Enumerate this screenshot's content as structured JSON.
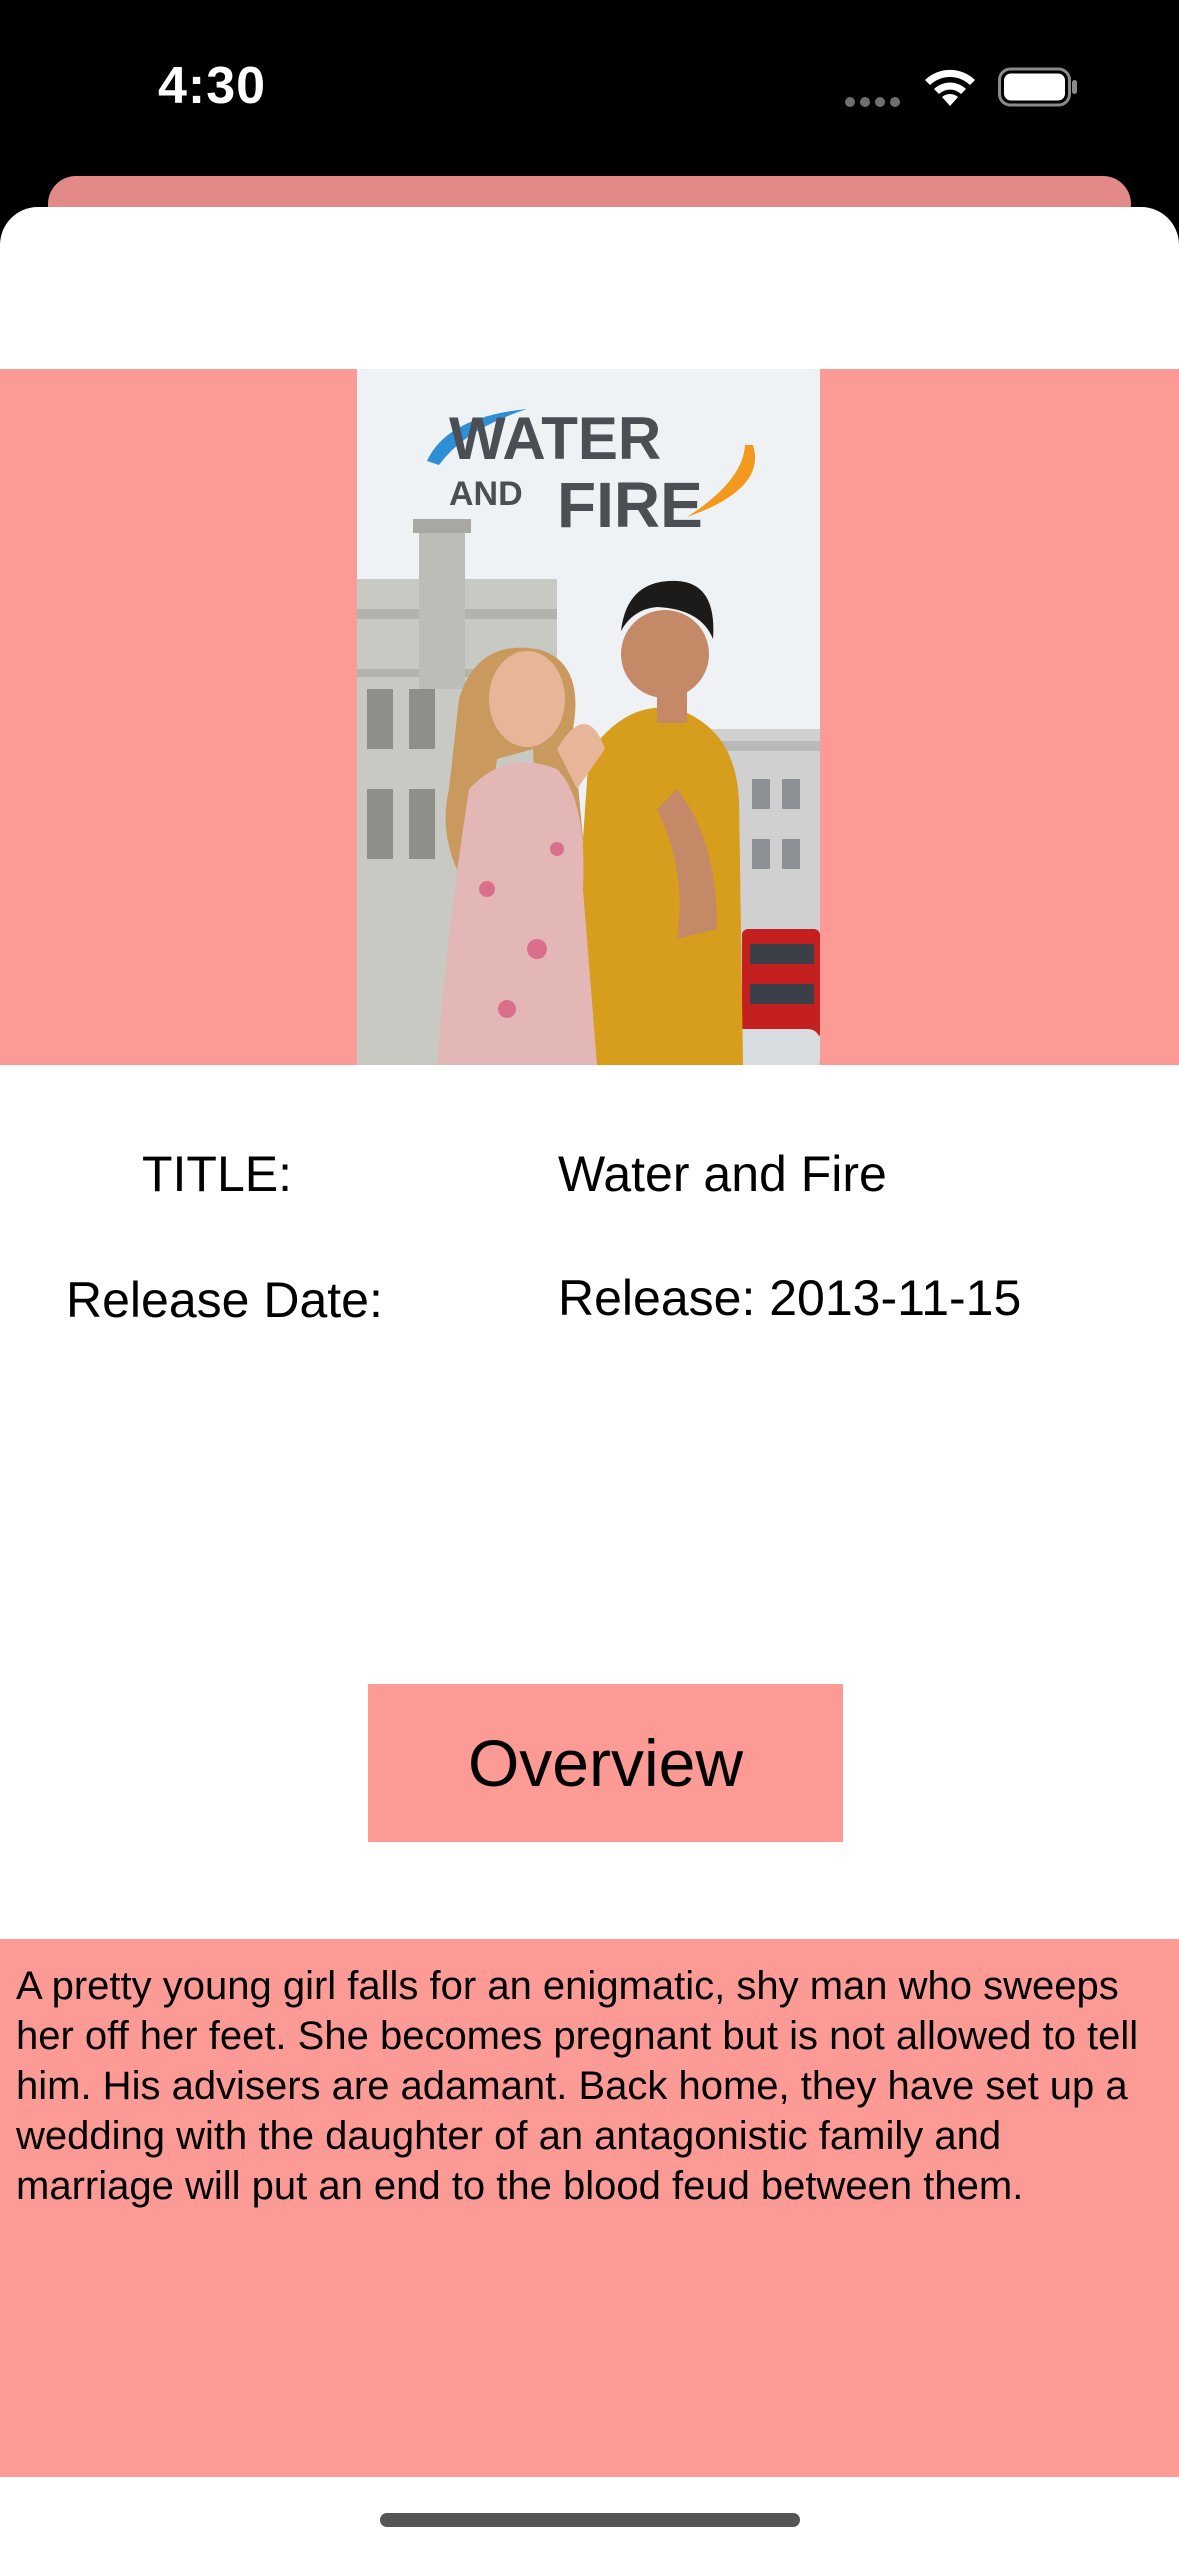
{
  "status_bar": {
    "time": "4:30"
  },
  "poster": {
    "logo_line1": "WATER",
    "logo_line2a": "AND",
    "logo_line2b": "FIRE",
    "colors": {
      "band": "#fc9a96",
      "sheet_back": "#e38a88"
    }
  },
  "details": {
    "title_label": "TITLE:",
    "title_value": "Water and Fire",
    "release_label": "Release Date:",
    "release_value": "Release: 2013-11-15"
  },
  "overview": {
    "button_label": "Overview",
    "text": "A pretty young girl falls for an enigmatic, shy man who sweeps her off her feet. She becomes pregnant but is not allowed to tell him. His advisers are adamant. Back home, they have set up a wedding with the daughter of an antagonistic family and marriage will put an end to the blood feud between them."
  }
}
